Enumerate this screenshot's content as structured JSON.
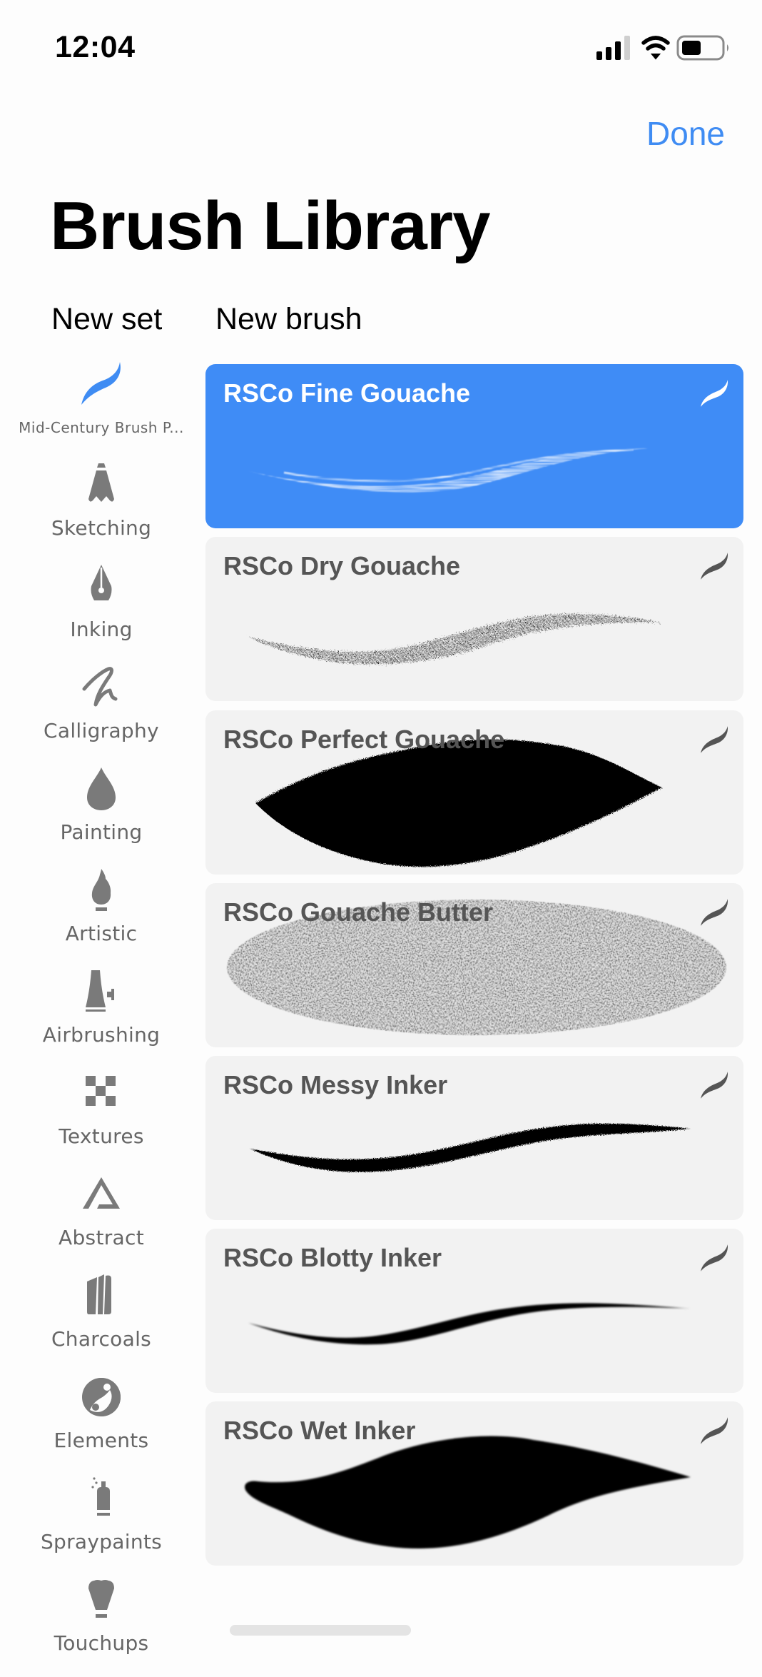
{
  "status_bar": {
    "time": "12:04",
    "signal_bars": 3,
    "signal_bars_total": 4,
    "battery_level_fraction": 0.4,
    "icons": [
      "cellular-signal-icon",
      "wifi-icon",
      "battery-icon"
    ]
  },
  "header": {
    "done_label": "Done",
    "title": "Brush Library",
    "new_set_label": "New set",
    "new_brush_label": "New brush"
  },
  "colors": {
    "accent": "#3f8cf3",
    "selected_card": "#3f8cf6",
    "card_background": "#f2f2f2",
    "sidebar_icon": "#7a7a7a",
    "sidebar_label": "#666666",
    "card_title": "#555555"
  },
  "brush_sets": [
    {
      "label": "Mid-Century Brush P...",
      "icon": "procreate-brush-icon",
      "selected": true
    },
    {
      "label": "Sketching",
      "icon": "pencil-tip-icon"
    },
    {
      "label": "Inking",
      "icon": "pen-nib-icon"
    },
    {
      "label": "Calligraphy",
      "icon": "calligraphy-stroke-icon"
    },
    {
      "label": "Painting",
      "icon": "paint-drop-icon"
    },
    {
      "label": "Artistic",
      "icon": "flame-icon"
    },
    {
      "label": "Airbrushing",
      "icon": "airbrush-icon"
    },
    {
      "label": "Textures",
      "icon": "checker-icon"
    },
    {
      "label": "Abstract",
      "icon": "triangle-icon"
    },
    {
      "label": "Charcoals",
      "icon": "charcoal-icon"
    },
    {
      "label": "Elements",
      "icon": "yin-yang-icon"
    },
    {
      "label": "Spraypaints",
      "icon": "spray-can-icon"
    },
    {
      "label": "Touchups",
      "icon": "makeup-brush-icon"
    }
  ],
  "brushes": [
    {
      "name": "RSCo Fine Gouache",
      "stroke": "fine-gouache",
      "selected": true
    },
    {
      "name": "RSCo Dry Gouache",
      "stroke": "dry-gouache"
    },
    {
      "name": "RSCo Perfect Gouache",
      "stroke": "perfect-gouache"
    },
    {
      "name": "RSCo Gouache Butter",
      "stroke": "gouache-butter"
    },
    {
      "name": "RSCo Messy Inker",
      "stroke": "messy-inker"
    },
    {
      "name": "RSCo Blotty Inker",
      "stroke": "blotty-inker"
    },
    {
      "name": "RSCo Wet Inker",
      "stroke": "wet-inker"
    }
  ]
}
